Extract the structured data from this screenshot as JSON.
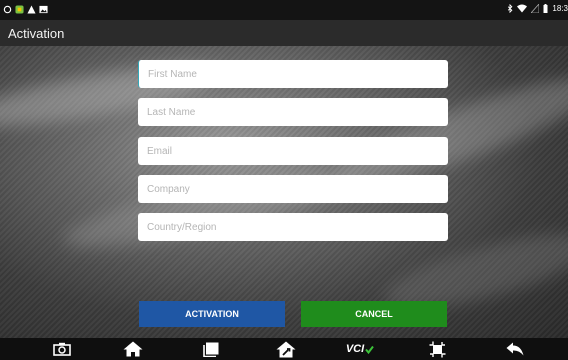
{
  "status_bar": {
    "left_icons": [
      "sync-icon",
      "app-icon",
      "warning-icon",
      "image-icon"
    ],
    "right_icons": [
      "bluetooth-icon",
      "wifi-icon",
      "signal-icon",
      "battery-icon"
    ],
    "time": "18:3"
  },
  "app_bar": {
    "title": "Activation"
  },
  "form": {
    "first_name_placeholder": "First Name",
    "last_name_placeholder": "Last Name",
    "email_placeholder": "Email",
    "company_placeholder": "Company",
    "country_placeholder": "Country/Region"
  },
  "buttons": {
    "activation_label": "ACTIVATION",
    "cancel_label": "CANCEL",
    "activation_color": "#1f57a5",
    "cancel_color": "#1f8c1c"
  },
  "nav_bar": {
    "items": [
      "camera-icon",
      "home-icon",
      "recent-apps-icon",
      "diagnostics-icon",
      "vci-icon",
      "screenshot-icon",
      "back-icon"
    ],
    "vci_label": "VCI"
  }
}
